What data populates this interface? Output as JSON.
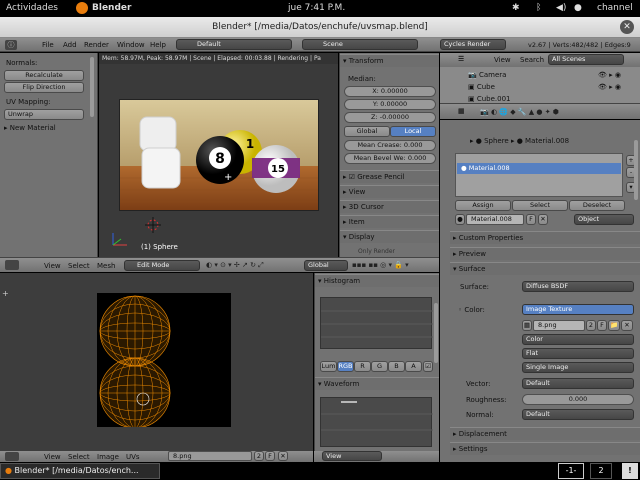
{
  "topbar": {
    "activities": "Actividades",
    "app": "Blender",
    "clock": "jue  7:41 P.M.",
    "user": "channel"
  },
  "window": {
    "title": "Blender* [/media/Datos/enchufe/uvsmap.blend]"
  },
  "infobar": {
    "menus": [
      "File",
      "Add",
      "Render",
      "Window",
      "Help"
    ],
    "layout": "Default",
    "scene": "Scene",
    "engine": "Cycles Render",
    "stats": "v2.67 | Verts:482/482 | Edges:9"
  },
  "toolshelf": {
    "normals_label": "Normals:",
    "recalculate": "Recalculate",
    "flip": "Flip Direction",
    "uv_label": "UV Mapping:",
    "unwrap": "Unwrap",
    "new_material": "New Material"
  },
  "viewport": {
    "status": "Mem: 58.97M, Peak: 58.97M | Scene | Elapsed: 00:03.88 | Rendering | Pa",
    "object_label": "(1) Sphere",
    "menus": [
      "View",
      "Select",
      "Mesh"
    ],
    "mode": "Edit Mode",
    "orientation": "Global",
    "balls": [
      "8",
      "1",
      "15"
    ]
  },
  "npanel": {
    "transform": "Transform",
    "median": "Median:",
    "x": "X: 0.00000",
    "y": "Y: 0.00000",
    "z": "Z: -0.00000",
    "global": "Global",
    "local": "Local",
    "crease": "Mean Crease: 0.000",
    "bevel": "Mean Bevel We: 0.000",
    "grease": "Grease Pencil",
    "view": "View",
    "cursor": "3D Cursor",
    "item": "Item",
    "display": "Display",
    "more": "Only Render"
  },
  "outliner": {
    "view": "View",
    "search": "Search",
    "filter": "All Scenes",
    "items": [
      "Camera",
      "Cube",
      "Cube.001"
    ]
  },
  "properties": {
    "breadcrumb_obj": "Sphere",
    "breadcrumb_mat": "Material.008",
    "slot": "Material.008",
    "assign": "Assign",
    "select": "Select",
    "deselect": "Deselect",
    "mat_name": "Material.008",
    "mat_f": "F",
    "link": "Object",
    "custom": "Custom Properties",
    "preview": "Preview",
    "surface_header": "Surface",
    "surface_label": "Surface:",
    "surface_val": "Diffuse BSDF",
    "color_label": "Color:",
    "color_val": "Image Texture",
    "image": "8.png",
    "image_users": "2",
    "image_f": "F",
    "color_mode": "Color",
    "projection": "Flat",
    "source": "Single Image",
    "vector_label": "Vector:",
    "vector_val": "Default",
    "rough_label": "Roughness:",
    "rough_val": "0.000",
    "normal_label": "Normal:",
    "normal_val": "Default",
    "displacement": "Displacement",
    "settings": "Settings"
  },
  "uveditor": {
    "menus": [
      "View",
      "Select",
      "Image",
      "UVs"
    ],
    "image": "8.png",
    "users": "2",
    "f": "F",
    "view": "View"
  },
  "scopes": {
    "histogram": "Histogram",
    "channels": [
      "Lum",
      "RGB",
      "R",
      "G",
      "B",
      "A"
    ],
    "waveform": "Waveform"
  },
  "taskbar": {
    "task": "Blender* [/media/Datos/ench...",
    "ws1": "-1-",
    "ws2": "2",
    "notify": "!"
  },
  "colors": {
    "uv_orange": "#f08c00",
    "select_blue": "#5680c2",
    "panel_gray": "#727272"
  }
}
